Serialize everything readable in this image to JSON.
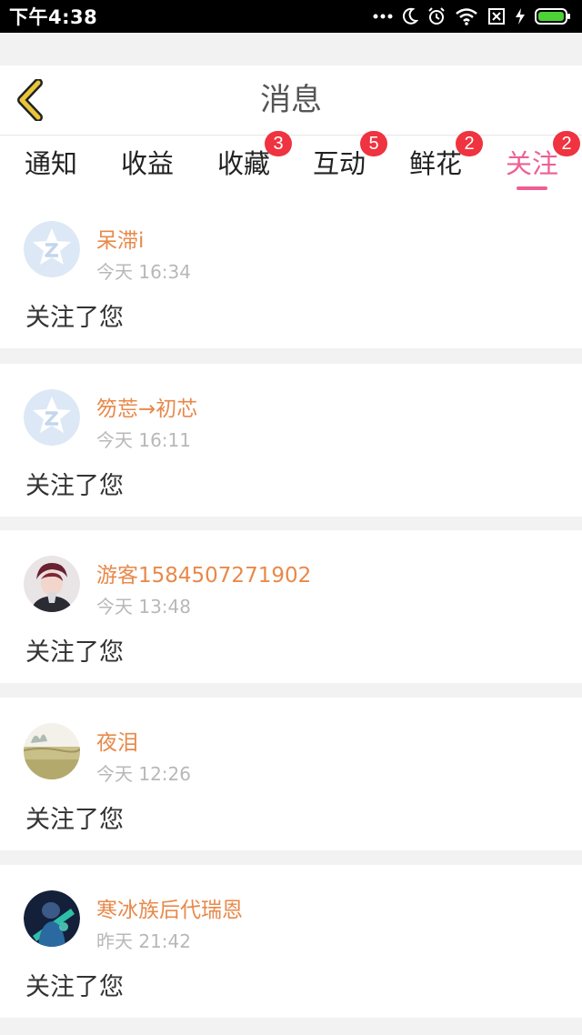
{
  "statusbar": {
    "time": "下午4:38",
    "icons": [
      "more-dots-icon",
      "moon-icon",
      "alarm-icon",
      "wifi-icon",
      "sim-off-icon",
      "charging-icon",
      "battery-icon"
    ]
  },
  "header": {
    "back_icon": "chevron-left-icon",
    "title": "消息"
  },
  "tabs": [
    {
      "label": "通知",
      "badge": ""
    },
    {
      "label": "收益",
      "badge": ""
    },
    {
      "label": "收藏",
      "badge": "3"
    },
    {
      "label": "互动",
      "badge": "5"
    },
    {
      "label": "鲜花",
      "badge": "2"
    },
    {
      "label": "关注",
      "badge": "2",
      "active": true
    }
  ],
  "colors": {
    "accent": "#ee5f93",
    "badge": "#ef3340",
    "username": "#e8894a",
    "back_arrow": "#e8c53a"
  },
  "messages": [
    {
      "name": "呆滞i",
      "time": "今天 16:34",
      "action": "关注了您",
      "avatar": "default-qq-avatar-icon"
    },
    {
      "name": "笏莣→初芯",
      "time": "今天 16:11",
      "action": "关注了您",
      "avatar": "default-qq-avatar-icon"
    },
    {
      "name": "游客1584507271902",
      "time": "今天 13:48",
      "action": "关注了您",
      "avatar": "user-photo-avatar"
    },
    {
      "name": "夜泪",
      "time": "今天 12:26",
      "action": "关注了您",
      "avatar": "landscape-photo-avatar"
    },
    {
      "name": "寒冰族后代瑞恩",
      "time": "昨天 21:42",
      "action": "关注了您",
      "avatar": "game-character-avatar"
    }
  ]
}
